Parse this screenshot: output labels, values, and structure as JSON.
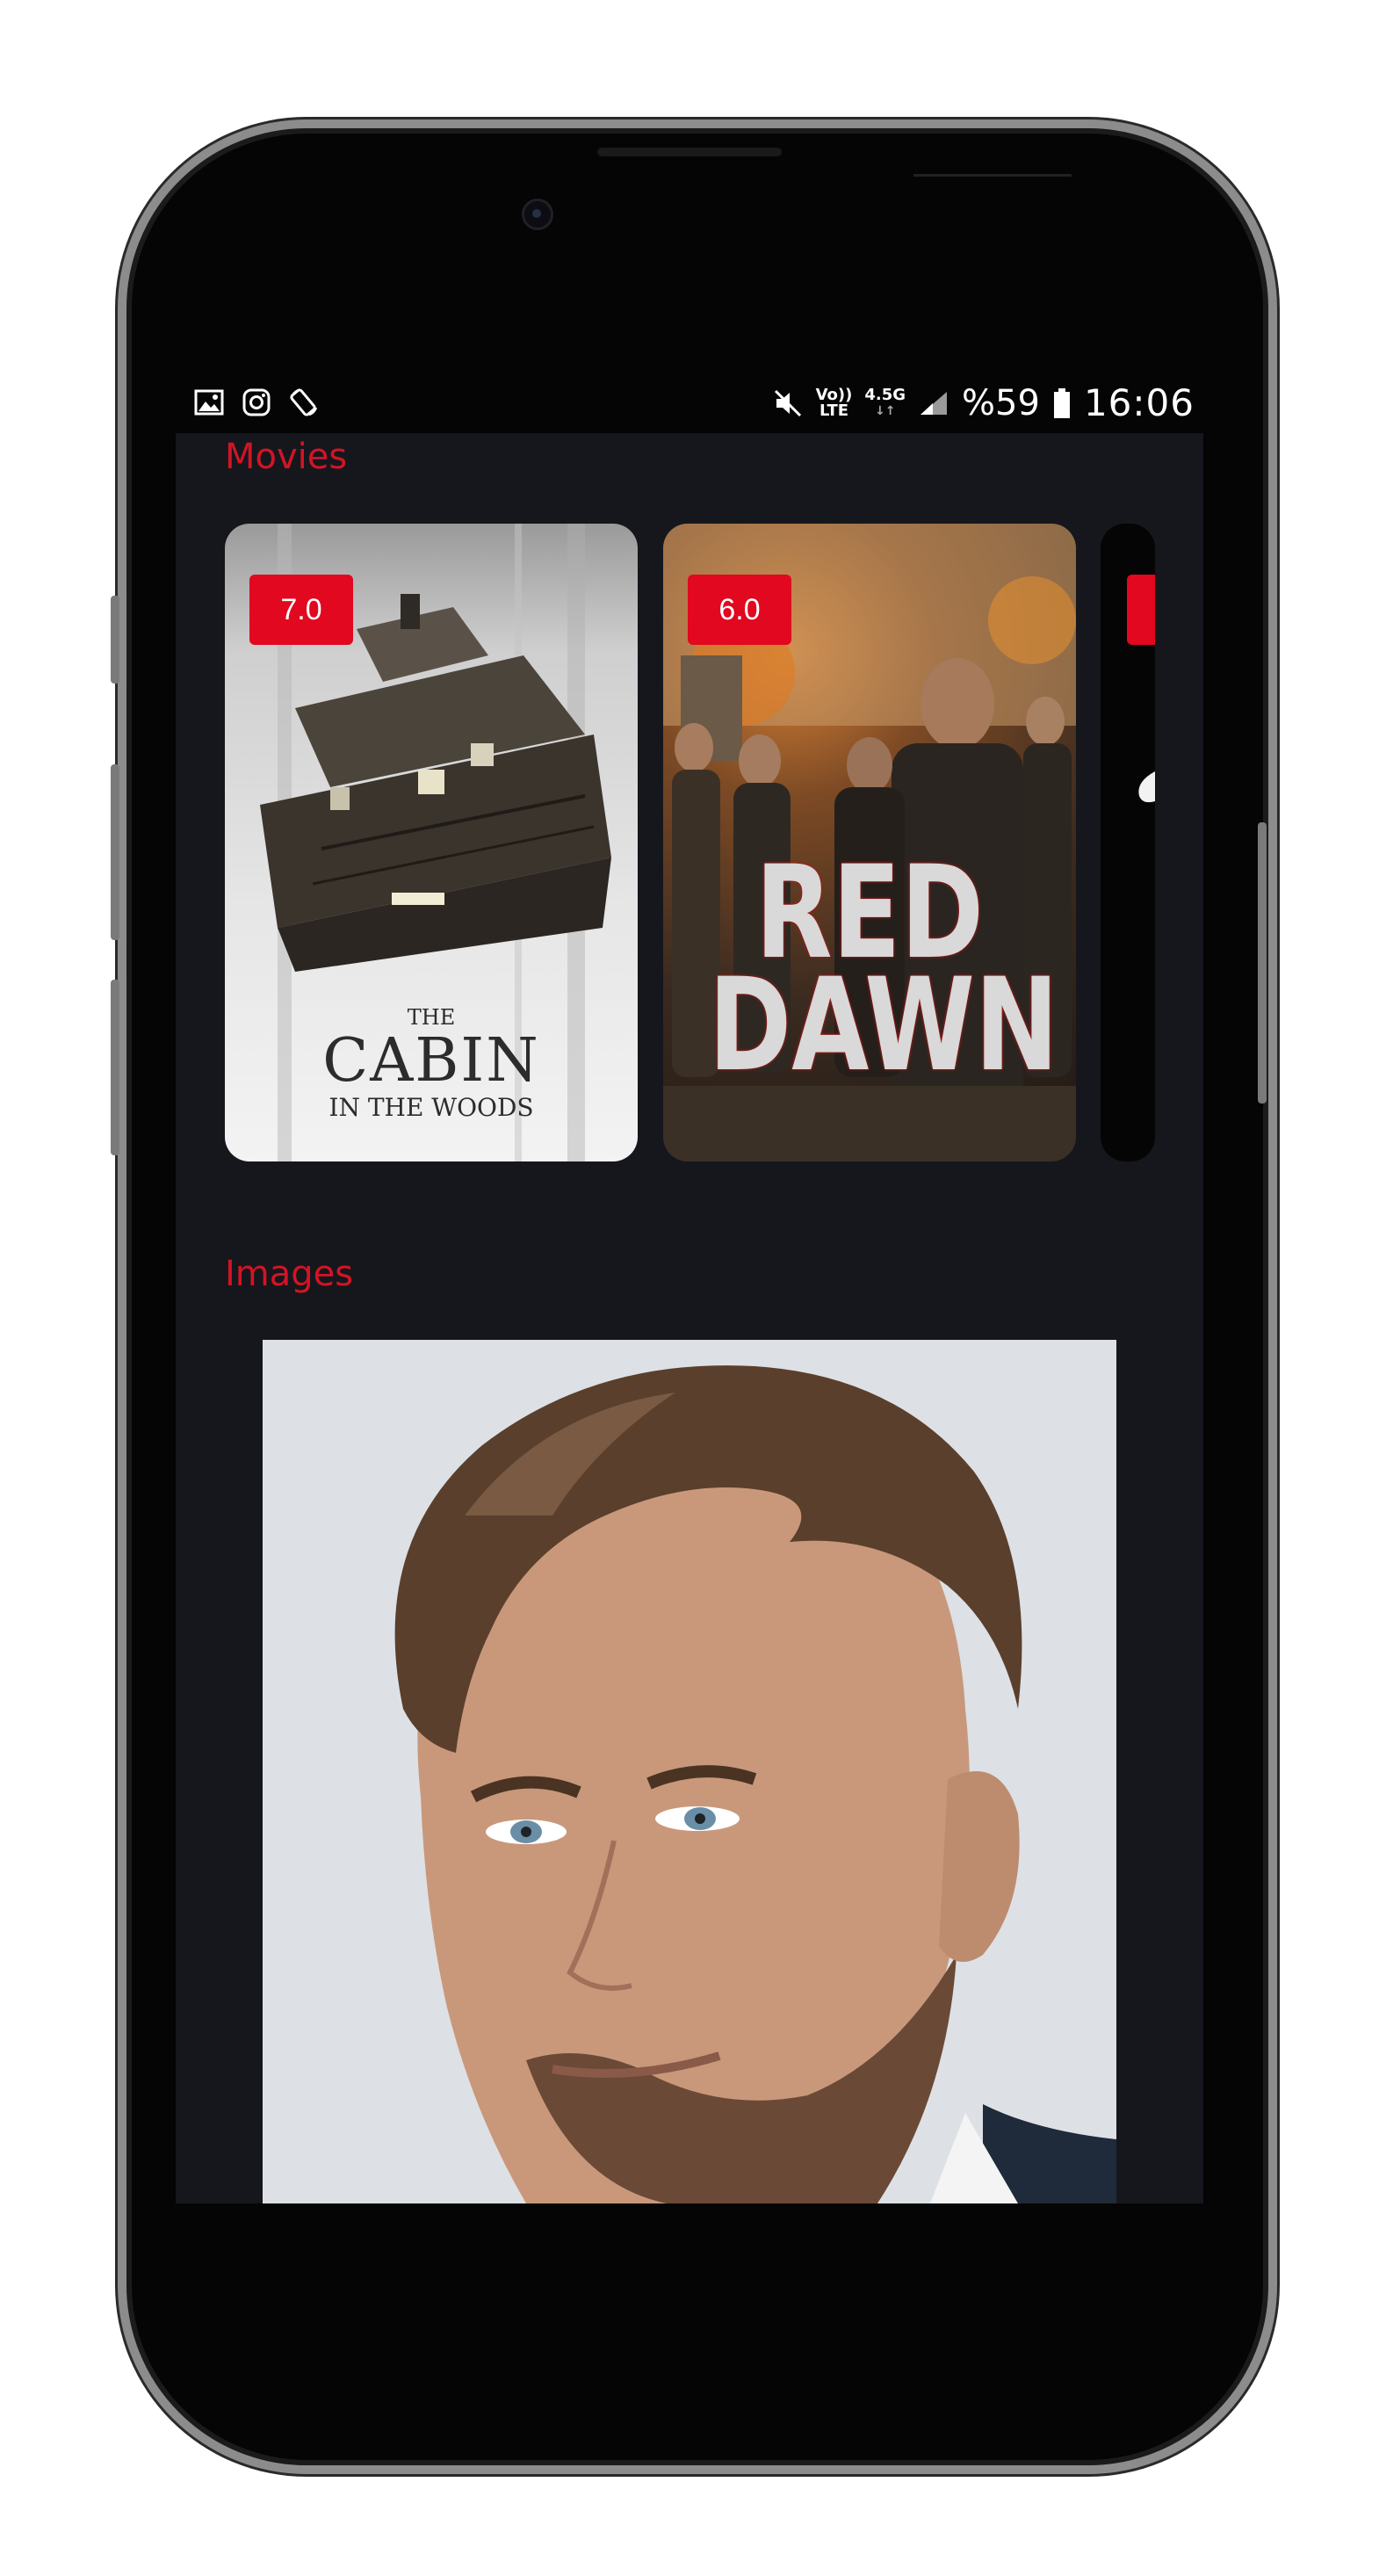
{
  "status_bar": {
    "left_icons": [
      "gallery-icon",
      "instagram-icon",
      "screen-rotate-icon"
    ],
    "right_icons": [
      "mute-icon",
      "volte-icon",
      "network-4g-icon",
      "signal-icon",
      "battery-icon"
    ],
    "volte_label_top": "Vo))",
    "volte_label_bottom": "LTE",
    "network_label": "4.5G",
    "battery": "%59",
    "time": "16:06"
  },
  "movies": {
    "title": "Movies",
    "items": [
      {
        "rating": "7.0",
        "poster_title_line1": "THE",
        "poster_title_line2": "CABIN",
        "poster_title_line3": "IN THE WOODS"
      },
      {
        "rating": "6.0",
        "poster_title_line1": "RED",
        "poster_title_line2": "DAWN"
      },
      {
        "rating": ""
      }
    ]
  },
  "images": {
    "title": "Images"
  },
  "colors": {
    "accent": "#e1081f",
    "section_title": "#d31424",
    "screen_bg": "#16171d"
  }
}
